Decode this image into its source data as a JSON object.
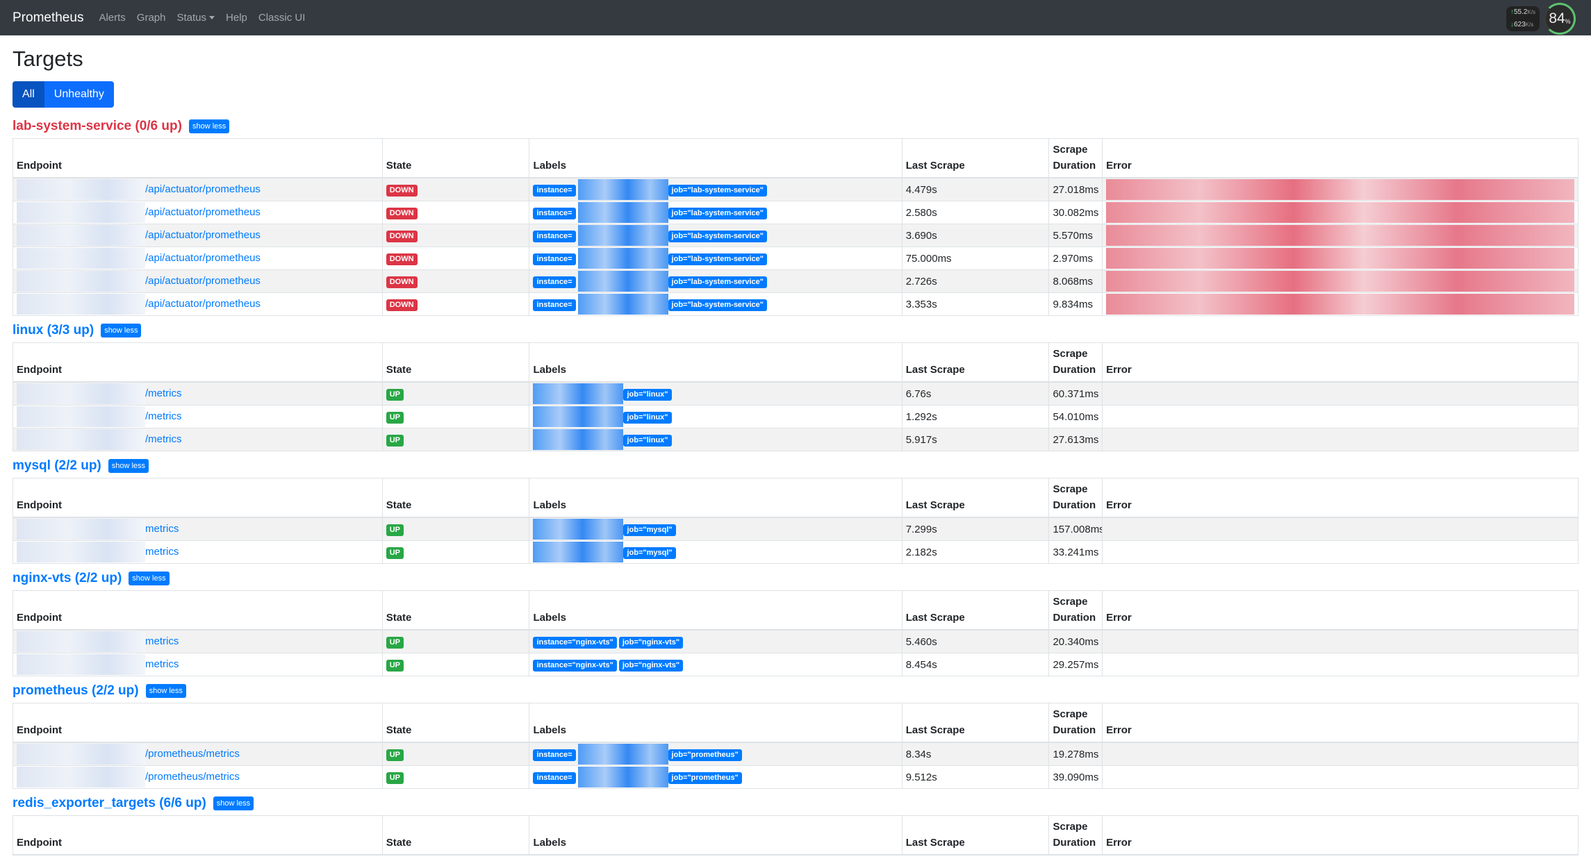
{
  "navbar": {
    "brand": "Prometheus",
    "links": [
      "Alerts",
      "Graph",
      "Status",
      "Help",
      "Classic UI"
    ],
    "upload_speed": "55.2",
    "download_speed": "623",
    "speed_unit": "K/s",
    "cpu_percent": "84",
    "percent_sign": "%"
  },
  "page": {
    "title": "Targets",
    "filter_all": "All",
    "filter_unhealthy": "Unhealthy"
  },
  "columns": {
    "endpoint": "Endpoint",
    "state": "State",
    "labels": "Labels",
    "last_scrape": "Last Scrape",
    "scrape_duration_line1": "Scrape",
    "scrape_duration_line2": "Duration",
    "error": "Error"
  },
  "show_less": "show less",
  "jobs": [
    {
      "title": "lab-system-service (0/6 up)",
      "unhealthy": true,
      "rows": [
        {
          "endpoint": "/api/actuator/prometheus",
          "state": "DOWN",
          "instance": "instance=",
          "job": "job=\"lab-system-service\"",
          "last_scrape": "4.479s",
          "duration": "27.018ms"
        },
        {
          "endpoint": "/api/actuator/prometheus",
          "state": "DOWN",
          "instance": "instance=",
          "job": "job=\"lab-system-service\"",
          "last_scrape": "2.580s",
          "duration": "30.082ms"
        },
        {
          "endpoint": "/api/actuator/prometheus",
          "state": "DOWN",
          "instance": "instance=",
          "job": "job=\"lab-system-service\"",
          "last_scrape": "3.690s",
          "duration": "5.570ms"
        },
        {
          "endpoint": "/api/actuator/prometheus",
          "state": "DOWN",
          "instance": "instance=",
          "job": "job=\"lab-system-service\"",
          "last_scrape": "75.000ms",
          "duration": "2.970ms"
        },
        {
          "endpoint": "/api/actuator/prometheus",
          "state": "DOWN",
          "instance": "instance=",
          "job": "job=\"lab-system-service\"",
          "last_scrape": "2.726s",
          "duration": "8.068ms"
        },
        {
          "endpoint": "/api/actuator/prometheus",
          "state": "DOWN",
          "instance": "instance=",
          "job": "job=\"lab-system-service\"",
          "last_scrape": "3.353s",
          "duration": "9.834ms"
        }
      ]
    },
    {
      "title": "linux (3/3 up)",
      "unhealthy": false,
      "rows": [
        {
          "endpoint": "/metrics",
          "state": "UP",
          "instance": "",
          "job": "job=\"linux\"",
          "last_scrape": "6.76s",
          "duration": "60.371ms"
        },
        {
          "endpoint": "/metrics",
          "state": "UP",
          "instance": "",
          "job": "job=\"linux\"",
          "last_scrape": "1.292s",
          "duration": "54.010ms"
        },
        {
          "endpoint": "/metrics",
          "state": "UP",
          "instance": "",
          "job": "job=\"linux\"",
          "last_scrape": "5.917s",
          "duration": "27.613ms"
        }
      ]
    },
    {
      "title": "mysql (2/2 up)",
      "unhealthy": false,
      "rows": [
        {
          "endpoint": "metrics",
          "state": "UP",
          "instance": "",
          "job": "job=\"mysql\"",
          "last_scrape": "7.299s",
          "duration": "157.008ms"
        },
        {
          "endpoint": "metrics",
          "state": "UP",
          "instance": "",
          "job": "job=\"mysql\"",
          "last_scrape": "2.182s",
          "duration": "33.241ms"
        }
      ]
    },
    {
      "title": "nginx-vts (2/2 up)",
      "unhealthy": false,
      "rows": [
        {
          "endpoint": "metrics",
          "state": "UP",
          "instance": "instance=\"nginx-vts\"",
          "job": "job=\"nginx-vts\"",
          "last_scrape": "5.460s",
          "duration": "20.340ms"
        },
        {
          "endpoint": "metrics",
          "state": "UP",
          "instance": "instance=\"nginx-vts\"",
          "job": "job=\"nginx-vts\"",
          "last_scrape": "8.454s",
          "duration": "29.257ms"
        }
      ]
    },
    {
      "title": "prometheus (2/2 up)",
      "unhealthy": false,
      "rows": [
        {
          "endpoint": "/prometheus/metrics",
          "state": "UP",
          "instance": "instance=",
          "job": "job=\"prometheus\"",
          "last_scrape": "8.34s",
          "duration": "19.278ms"
        },
        {
          "endpoint": "/prometheus/metrics",
          "state": "UP",
          "instance": "instance=",
          "job": "job=\"prometheus\"",
          "last_scrape": "9.512s",
          "duration": "39.090ms"
        }
      ]
    },
    {
      "title": "redis_exporter_targets (6/6 up)",
      "unhealthy": false,
      "rows": []
    }
  ]
}
